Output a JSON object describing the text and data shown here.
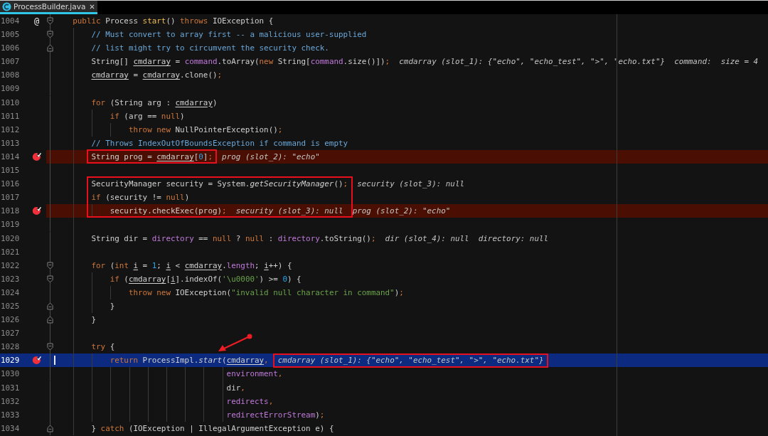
{
  "tab": {
    "title": "ProcessBuilder.java",
    "selected": true
  },
  "lines": [
    {
      "number": "1004",
      "marker": {
        "kind": "override",
        "text": "@"
      },
      "fold": {
        "kind": "start"
      },
      "code_boxed": false,
      "segments": [
        {
          "text": "    public",
          "kind": "kw"
        },
        {
          "text": " Process ",
          "kind": "plain"
        },
        {
          "text": "start",
          "kind": "decl"
        },
        {
          "text": "() ",
          "kind": "plain"
        },
        {
          "text": "throws",
          "kind": "kw"
        },
        {
          "text": " IOException {",
          "kind": "plain"
        }
      ]
    },
    {
      "number": "1005",
      "fold": {
        "kind": "start"
      },
      "code_boxed": false,
      "segments": [
        {
          "text": "        // Must convert to array first -- a malicious user-supplied",
          "kind": "comment"
        }
      ]
    },
    {
      "number": "1006",
      "fold": {
        "kind": "end"
      },
      "code_boxed": false,
      "segments": [
        {
          "text": "        // list might try to circumvent the security check.",
          "kind": "comment"
        }
      ]
    },
    {
      "number": "1007",
      "code_boxed": false,
      "segments": [
        {
          "text": "        String[] ",
          "kind": "plain"
        },
        {
          "text": "cmdarray",
          "kind": "var"
        },
        {
          "text": " = ",
          "kind": "plain"
        },
        {
          "text": "command",
          "kind": "field"
        },
        {
          "text": ".toArray(",
          "kind": "plain"
        },
        {
          "text": "new",
          "kind": "kw"
        },
        {
          "text": " String[",
          "kind": "plain"
        },
        {
          "text": "command",
          "kind": "field"
        },
        {
          "text": ".size()])",
          "kind": "plain"
        },
        {
          "text": ";",
          "kind": "kw"
        }
      ],
      "hints": [
        {
          "text": "cmdarray (slot_1): {\"echo\", \"echo_test\", \">\", \"echo.txt\"}",
          "boxed": false
        },
        {
          "text": "command:  size = 4",
          "boxed": false
        }
      ]
    },
    {
      "number": "1008",
      "code_boxed": false,
      "segments": [
        {
          "text": "        cmdarray",
          "kind": "var"
        },
        {
          "text": " = ",
          "kind": "plain"
        },
        {
          "text": "cmdarray",
          "kind": "var"
        },
        {
          "text": ".clone()",
          "kind": "plain"
        },
        {
          "text": ";",
          "kind": "kw"
        }
      ]
    },
    {
      "number": "1009",
      "code_boxed": false
    },
    {
      "number": "1010",
      "code_boxed": false,
      "segments": [
        {
          "text": "        for",
          "kind": "kw"
        },
        {
          "text": " (String arg : ",
          "kind": "plain"
        },
        {
          "text": "cmdarray",
          "kind": "var"
        },
        {
          "text": ")",
          "kind": "plain"
        }
      ]
    },
    {
      "number": "1011",
      "code_boxed": false,
      "segments": [
        {
          "text": "            if",
          "kind": "kw"
        },
        {
          "text": " (arg == ",
          "kind": "plain"
        },
        {
          "text": "null",
          "kind": "kw"
        },
        {
          "text": ")",
          "kind": "plain"
        }
      ]
    },
    {
      "number": "1012",
      "code_boxed": false,
      "segments": [
        {
          "text": "                throw new",
          "kind": "kw"
        },
        {
          "text": " NullPointerException()",
          "kind": "plain"
        },
        {
          "text": ";",
          "kind": "kw"
        }
      ]
    },
    {
      "number": "1013",
      "code_boxed": false,
      "segments": [
        {
          "text": "        // Throws IndexOutOfBoundsException if command is empty",
          "kind": "comment"
        }
      ]
    },
    {
      "number": "1014",
      "marker": {
        "kind": "breakpoint"
      },
      "highlight": {
        "kind": "breakpoint"
      },
      "code_boxed": true,
      "segments": [
        {
          "text": "        String prog = ",
          "kind": "plain"
        },
        {
          "text": "cmdarray",
          "kind": "var"
        },
        {
          "text": "[",
          "kind": "plain"
        },
        {
          "text": "0",
          "kind": "num"
        },
        {
          "text": "]",
          "kind": "plain"
        },
        {
          "text": ";",
          "kind": "kw"
        }
      ],
      "hints": [
        {
          "text": "prog (slot_2): \"echo\"",
          "boxed": false
        }
      ]
    },
    {
      "number": "1015",
      "code_boxed": false
    },
    {
      "number": "1016",
      "code_boxed": true,
      "segments": [
        {
          "text": "        SecurityManager security = System.",
          "kind": "plain"
        },
        {
          "text": "getSecurityManager",
          "kind": "call"
        },
        {
          "text": "()",
          "kind": "plain"
        },
        {
          "text": ";",
          "kind": "kw"
        }
      ],
      "hints": [
        {
          "text": "security (slot_3): null",
          "boxed": false
        }
      ]
    },
    {
      "number": "1017",
      "code_boxed": true,
      "segments": [
        {
          "text": "        if",
          "kind": "kw"
        },
        {
          "text": " (security != ",
          "kind": "plain"
        },
        {
          "text": "null",
          "kind": "kw"
        },
        {
          "text": ")",
          "kind": "plain"
        }
      ]
    },
    {
      "number": "1018",
      "marker": {
        "kind": "breakpoint"
      },
      "highlight": {
        "kind": "breakpoint"
      },
      "code_boxed": true,
      "segments": [
        {
          "text": "            security.checkExec(prog)",
          "kind": "plain"
        },
        {
          "text": ";",
          "kind": "kw"
        }
      ],
      "hints": [
        {
          "text": "security (slot_3): null",
          "boxed": true
        },
        {
          "text": "prog (slot_2): \"echo\"",
          "boxed": false
        }
      ]
    },
    {
      "number": "1019",
      "code_boxed": false
    },
    {
      "number": "1020",
      "code_boxed": false,
      "segments": [
        {
          "text": "        String dir = ",
          "kind": "plain"
        },
        {
          "text": "directory",
          "kind": "field"
        },
        {
          "text": " == ",
          "kind": "plain"
        },
        {
          "text": "null",
          "kind": "kw"
        },
        {
          "text": " ? ",
          "kind": "plain"
        },
        {
          "text": "null",
          "kind": "kw"
        },
        {
          "text": " : ",
          "kind": "plain"
        },
        {
          "text": "directory",
          "kind": "field"
        },
        {
          "text": ".toString()",
          "kind": "plain"
        },
        {
          "text": ";",
          "kind": "kw"
        }
      ],
      "hints": [
        {
          "text": "dir (slot_4): null",
          "boxed": false
        },
        {
          "text": "directory: null",
          "boxed": false
        }
      ]
    },
    {
      "number": "1021",
      "code_boxed": false
    },
    {
      "number": "1022",
      "fold": {
        "kind": "start"
      },
      "code_boxed": false,
      "segments": [
        {
          "text": "        for",
          "kind": "kw"
        },
        {
          "text": " (",
          "kind": "plain"
        },
        {
          "text": "int ",
          "kind": "kw"
        },
        {
          "text": "i",
          "kind": "var"
        },
        {
          "text": " = ",
          "kind": "plain"
        },
        {
          "text": "1",
          "kind": "num"
        },
        {
          "text": "; ",
          "kind": "plain"
        },
        {
          "text": "i",
          "kind": "var"
        },
        {
          "text": " < ",
          "kind": "plain"
        },
        {
          "text": "cmdarray",
          "kind": "var"
        },
        {
          "text": ".",
          "kind": "plain"
        },
        {
          "text": "length",
          "kind": "field"
        },
        {
          "text": "; ",
          "kind": "plain"
        },
        {
          "text": "i",
          "kind": "var"
        },
        {
          "text": "++) {",
          "kind": "plain"
        }
      ]
    },
    {
      "number": "1023",
      "fold": {
        "kind": "start"
      },
      "code_boxed": false,
      "segments": [
        {
          "text": "            if",
          "kind": "kw"
        },
        {
          "text": " (",
          "kind": "plain"
        },
        {
          "text": "cmdarray",
          "kind": "var"
        },
        {
          "text": "[",
          "kind": "plain"
        },
        {
          "text": "i",
          "kind": "var"
        },
        {
          "text": "].indexOf(",
          "kind": "plain"
        },
        {
          "text": "'\\u0000'",
          "kind": "str"
        },
        {
          "text": ") >= ",
          "kind": "plain"
        },
        {
          "text": "0",
          "kind": "num"
        },
        {
          "text": ") {",
          "kind": "plain"
        }
      ]
    },
    {
      "number": "1024",
      "code_boxed": false,
      "segments": [
        {
          "text": "                throw new",
          "kind": "kw"
        },
        {
          "text": " IOException(",
          "kind": "plain"
        },
        {
          "text": "\"invalid null character in command\"",
          "kind": "str"
        },
        {
          "text": ")",
          "kind": "plain"
        },
        {
          "text": ";",
          "kind": "kw"
        }
      ]
    },
    {
      "number": "1025",
      "fold": {
        "kind": "end"
      },
      "code_boxed": false,
      "segments": [
        {
          "text": "            }",
          "kind": "plain"
        }
      ]
    },
    {
      "number": "1026",
      "fold": {
        "kind": "end"
      },
      "code_boxed": false,
      "segments": [
        {
          "text": "        }",
          "kind": "plain"
        }
      ]
    },
    {
      "number": "1027",
      "code_boxed": false
    },
    {
      "number": "1028",
      "fold": {
        "kind": "start"
      },
      "code_boxed": false,
      "segments": [
        {
          "text": "        try",
          "kind": "kw"
        },
        {
          "text": " {",
          "kind": "plain"
        }
      ]
    },
    {
      "number": "1029",
      "marker": {
        "kind": "breakpoint"
      },
      "highlight": {
        "kind": "execution"
      },
      "code_boxed": false,
      "segments": [
        {
          "text": "            return",
          "kind": "kw"
        },
        {
          "text": " ProcessImpl.",
          "kind": "plain"
        },
        {
          "text": "start",
          "kind": "call"
        },
        {
          "text": "(",
          "kind": "plain"
        },
        {
          "text": "cmdarray",
          "kind": "var"
        },
        {
          "text": ",",
          "kind": "kw"
        }
      ],
      "hints": [
        {
          "text": "cmdarray (slot_1): {\"echo\", \"echo_test\", \">\", \"echo.txt\"}",
          "boxed": true
        }
      ]
    },
    {
      "number": "1030",
      "code_boxed": false,
      "segments": [
        {
          "text": "                                     environment",
          "kind": "field"
        },
        {
          "text": ",",
          "kind": "kw"
        }
      ]
    },
    {
      "number": "1031",
      "code_boxed": false,
      "segments": [
        {
          "text": "                                     dir",
          "kind": "plain"
        },
        {
          "text": ",",
          "kind": "kw"
        }
      ]
    },
    {
      "number": "1032",
      "code_boxed": false,
      "segments": [
        {
          "text": "                                     redirects",
          "kind": "field"
        },
        {
          "text": ",",
          "kind": "kw"
        }
      ]
    },
    {
      "number": "1033",
      "code_boxed": false,
      "segments": [
        {
          "text": "                                     redirectErrorStream",
          "kind": "field"
        },
        {
          "text": ")",
          "kind": "plain"
        },
        {
          "text": ";",
          "kind": "kw"
        }
      ]
    },
    {
      "number": "1034",
      "fold": {
        "kind": "end"
      },
      "code_boxed": false,
      "segments": [
        {
          "text": "        } ",
          "kind": "plain"
        },
        {
          "text": "catch",
          "kind": "kw"
        },
        {
          "text": " (IOException | IllegalArgumentException e) {",
          "kind": "plain"
        }
      ]
    }
  ]
}
